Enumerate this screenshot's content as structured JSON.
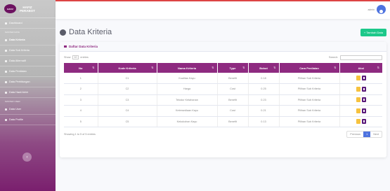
{
  "brand": {
    "logo_text": "HAFIZ",
    "line1": "HAFIZ",
    "line2": "PERABOT"
  },
  "sidebar": {
    "items": [
      {
        "label": "Dashboard",
        "active": false
      },
      {
        "heading": "MASTER DATA"
      },
      {
        "label": "Data Kriteria",
        "active": true
      },
      {
        "label": "Data Sub Kriteria",
        "active": false
      },
      {
        "label": "Data Alternatif",
        "active": false
      },
      {
        "label": "Data Penilaian",
        "active": false
      },
      {
        "label": "Data Perhitungan",
        "active": false
      },
      {
        "label": "Data Hasil Akhir",
        "active": false
      },
      {
        "heading": "MASTER USER"
      },
      {
        "label": "Data User",
        "active": false
      },
      {
        "label": "Data Profile",
        "active": false
      }
    ],
    "toggle_icon": "chevron-left-icon",
    "toggle_glyph": "‹"
  },
  "topbar": {
    "user_name": "admin",
    "avatar_icon": "user-avatar-icon"
  },
  "page": {
    "title": "Data Kriteria",
    "add_button": "+ Tambah Data"
  },
  "card": {
    "header": "Daftar Data Kriteria",
    "show_label": "Show",
    "show_value": "10",
    "entries_label": "entries",
    "search_label": "Search:",
    "columns": [
      "No",
      "Kode Kriteria",
      "Nama Kriteria",
      "Type",
      "Bobot",
      "Cara Penilaian",
      "Aksi"
    ],
    "rows": [
      {
        "no": "1",
        "kode": "C1",
        "nama": "Kualitas Kayu",
        "type": "Benefit",
        "bobot": "0.18",
        "cara": "Pilihan Sub Kriteria"
      },
      {
        "no": "2",
        "kode": "C2",
        "nama": "Harga",
        "type": "Cost",
        "bobot": "0.25",
        "cara": "Pilihan Sub Kriteria"
      },
      {
        "no": "3",
        "kode": "C3",
        "nama": "Tekstur Ketahanan",
        "type": "Benefit",
        "bobot": "0.23",
        "cara": "Pilihan Sub Kriteria"
      },
      {
        "no": "4",
        "kode": "C4",
        "nama": "Ketersediaan Kayu",
        "type": "Cost",
        "bobot": "0.21",
        "cara": "Pilihan Sub Kriteria"
      },
      {
        "no": "5",
        "kode": "C5",
        "nama": "Kekokohan Kayu",
        "type": "Benefit",
        "bobot": "0.13",
        "cara": "Pilihan Sub Kriteria"
      }
    ],
    "info": "Showing 1 to 5 of 5 entries",
    "pager": {
      "prev": "Previous",
      "current": "1",
      "next": "Next"
    }
  },
  "colors": {
    "accent": "#8e2a80",
    "add": "#1cc88a",
    "edit": "#f6c23e",
    "delete": "#5a1a7a",
    "page": "#4e73df"
  }
}
